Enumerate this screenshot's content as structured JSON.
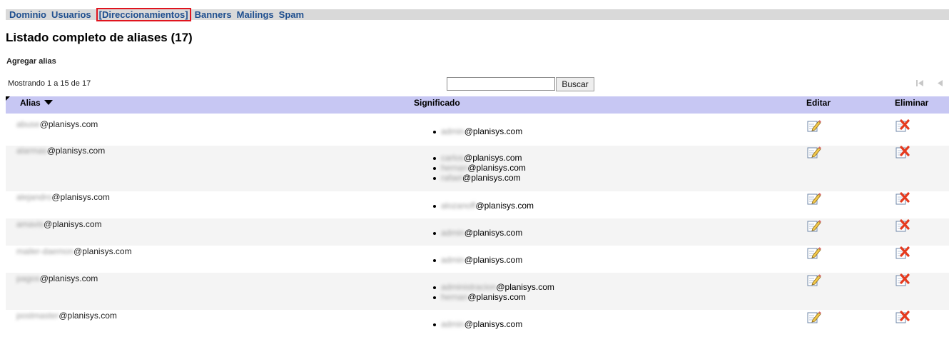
{
  "nav": {
    "items": [
      {
        "label": "Dominio",
        "active": false
      },
      {
        "label": "Usuarios",
        "active": false
      },
      {
        "label": "[Direccionamientos]",
        "active": true
      },
      {
        "label": "Banners",
        "active": false
      },
      {
        "label": "Mailings",
        "active": false
      },
      {
        "label": "Spam",
        "active": false
      }
    ]
  },
  "page": {
    "title": "Listado completo de aliases (17)",
    "add_alias_label": "Agregar alias",
    "showing_text": "Mostrando 1 a 15 de 17"
  },
  "search": {
    "value": "",
    "placeholder": "",
    "button_label": "Buscar"
  },
  "pager": {
    "first_icon": "first-page-icon",
    "prev_icon": "prev-page-icon"
  },
  "table": {
    "headers": {
      "alias": "Alias",
      "meaning": "Significado",
      "edit": "Editar",
      "delete": "Eliminar"
    },
    "rows": [
      {
        "alias_blurred": "abuse",
        "alias_domain": "@planisys.com",
        "meanings": [
          {
            "blurred": "admin",
            "domain": "@planisys.com"
          }
        ]
      },
      {
        "alias_blurred": "alarmas",
        "alias_domain": "@planisys.com",
        "meanings": [
          {
            "blurred": "carlos",
            "domain": "@planisys.com"
          },
          {
            "blurred": "hernan",
            "domain": "@planisys.com"
          },
          {
            "blurred": "rafael",
            "domain": "@planisys.com"
          }
        ]
      },
      {
        "alias_blurred": "alejandro",
        "alias_domain": "@planisys.com",
        "meanings": [
          {
            "blurred": "alozanoff",
            "domain": "@planisys.com"
          }
        ]
      },
      {
        "alias_blurred": "amavis",
        "alias_domain": "@planisys.com",
        "meanings": [
          {
            "blurred": "admin",
            "domain": "@planisys.com"
          }
        ]
      },
      {
        "alias_blurred": "mailer-daemon",
        "alias_domain": "@planisys.com",
        "meanings": [
          {
            "blurred": "admin",
            "domain": "@planisys.com"
          }
        ]
      },
      {
        "alias_blurred": "pagos",
        "alias_domain": "@planisys.com",
        "meanings": [
          {
            "blurred": "administracion",
            "domain": "@planisys.com"
          },
          {
            "blurred": "hernan",
            "domain": "@planisys.com"
          }
        ]
      },
      {
        "alias_blurred": "postmaster",
        "alias_domain": "@planisys.com",
        "meanings": [
          {
            "blurred": "admin",
            "domain": "@planisys.com"
          }
        ]
      }
    ]
  },
  "icons": {
    "edit": "edit-pencil-icon",
    "delete": "delete-x-icon"
  },
  "colors": {
    "nav_link": "#1f4f8f",
    "nav_bar_bg": "#d9d9d9",
    "active_outline": "#e0141e",
    "header_bg": "#c7c7f3",
    "row_alt_bg": "#f4f4f4"
  }
}
